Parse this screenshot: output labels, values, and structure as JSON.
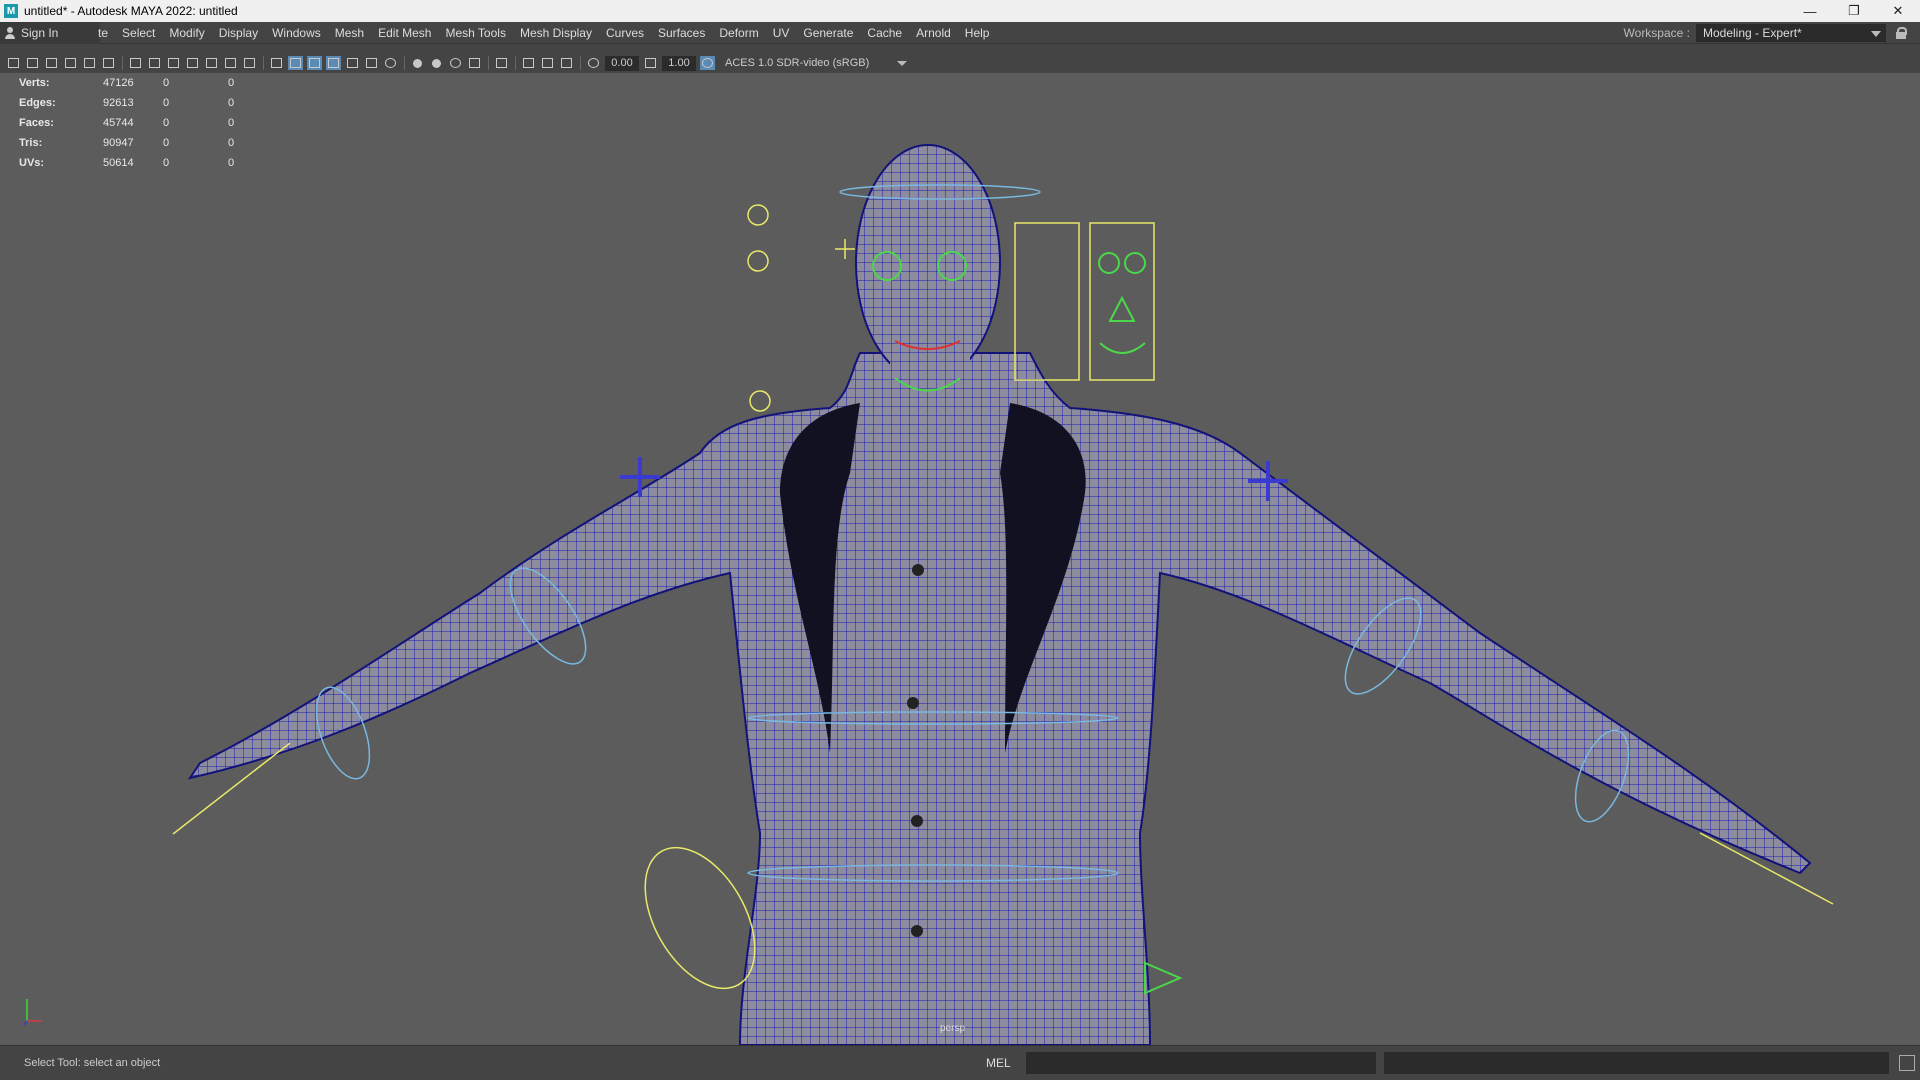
{
  "window": {
    "title": "untitled* - Autodesk MAYA 2022: untitled",
    "app_icon": "M",
    "controls": [
      "minimize-icon",
      "restore-icon",
      "close-icon"
    ]
  },
  "menubar": {
    "sign_in": "Sign In",
    "items": [
      "te",
      "Select",
      "Modify",
      "Display",
      "Windows",
      "Mesh",
      "Edit Mesh",
      "Mesh Tools",
      "Mesh Display",
      "Curves",
      "Surfaces",
      "Deform",
      "UV",
      "Generate",
      "Cache",
      "Arnold",
      "Help"
    ],
    "workspace_label": "Workspace :",
    "workspace_value": "Modeling - Expert*"
  },
  "panel_toolbar": {
    "exposure": "0.00",
    "gamma": "1.00",
    "color_space": "ACES 1.0 SDR-video (sRGB)"
  },
  "hud": {
    "rows": [
      {
        "label": "Verts:",
        "value": "47126",
        "a": "0",
        "b": "0"
      },
      {
        "label": "Edges:",
        "value": "92613",
        "a": "0",
        "b": "0"
      },
      {
        "label": "Faces:",
        "value": "45744",
        "a": "0",
        "b": "0"
      },
      {
        "label": "Tris:",
        "value": "90947",
        "a": "0",
        "b": "0"
      },
      {
        "label": "UVs:",
        "value": "50614",
        "a": "0",
        "b": "0"
      }
    ]
  },
  "viewport": {
    "camera_label": "persp",
    "mesh_color": "#8a8a9a",
    "wire_color": "#1a1ab0",
    "control_colors": {
      "yellow": "#e8e86a",
      "cyan": "#7ab8e0",
      "green": "#4ad84a",
      "blue": "#3a3ad0"
    }
  },
  "status": {
    "help_line": "Select Tool: select an object",
    "mel_label": "MEL"
  }
}
